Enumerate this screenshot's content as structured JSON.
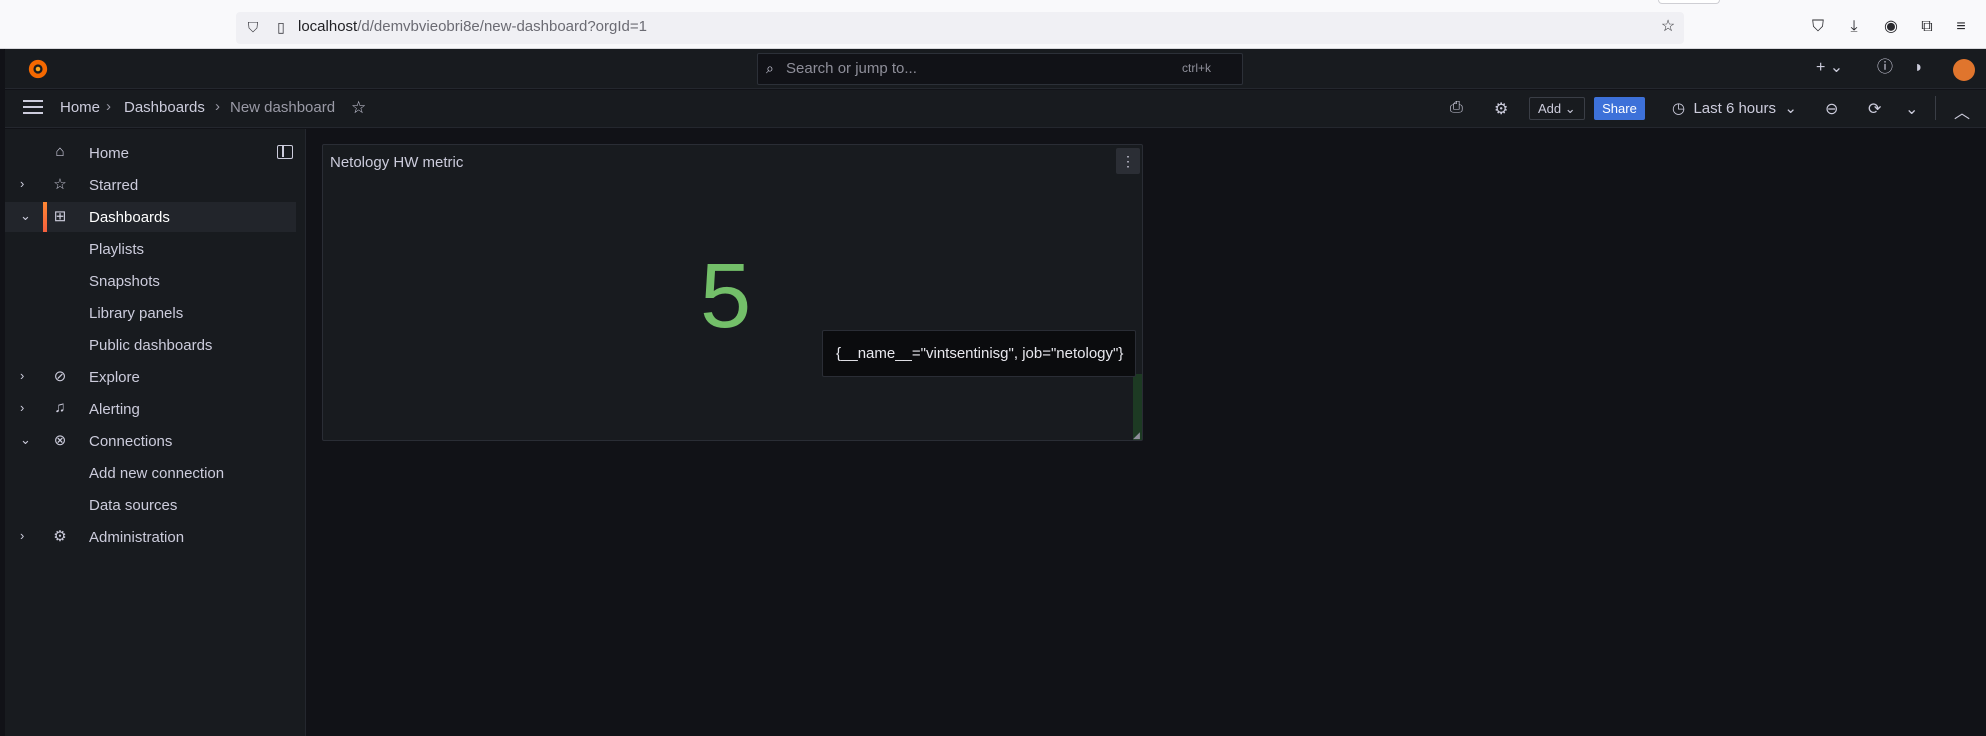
{
  "browser": {
    "url_host": "localhost",
    "url_path": "/d/demvbvieobri8e/new-dashboard?orgId=1"
  },
  "topbar": {
    "search_placeholder": "Search or jump to...",
    "search_shortcut": "ctrl+k"
  },
  "breadcrumb": {
    "items": [
      "Home",
      "Dashboards",
      "New dashboard"
    ],
    "separator": "›"
  },
  "toolbar": {
    "add_label": "Add",
    "share_label": "Share",
    "time_range": "Last 6 hours"
  },
  "sidebar": {
    "items": [
      {
        "label": "Home",
        "icon": "home-icon"
      },
      {
        "label": "Starred",
        "icon": "star-icon"
      },
      {
        "label": "Dashboards",
        "icon": "apps-icon"
      },
      {
        "label": "Playlists"
      },
      {
        "label": "Snapshots"
      },
      {
        "label": "Library panels"
      },
      {
        "label": "Public dashboards"
      },
      {
        "label": "Explore",
        "icon": "compass-icon"
      },
      {
        "label": "Alerting",
        "icon": "bell-icon"
      },
      {
        "label": "Connections",
        "icon": "link-icon"
      },
      {
        "label": "Add new connection"
      },
      {
        "label": "Data sources"
      },
      {
        "label": "Administration",
        "icon": "cog-icon"
      }
    ]
  },
  "panel": {
    "title": "Netology HW metric",
    "value": "5",
    "tooltip": "{__name__=\"vintsentinisg\", job=\"netology\"}",
    "value_color": "#73bf69"
  },
  "colors": {
    "accent": "#3d71d9",
    "active_bar": "#ff8833"
  }
}
